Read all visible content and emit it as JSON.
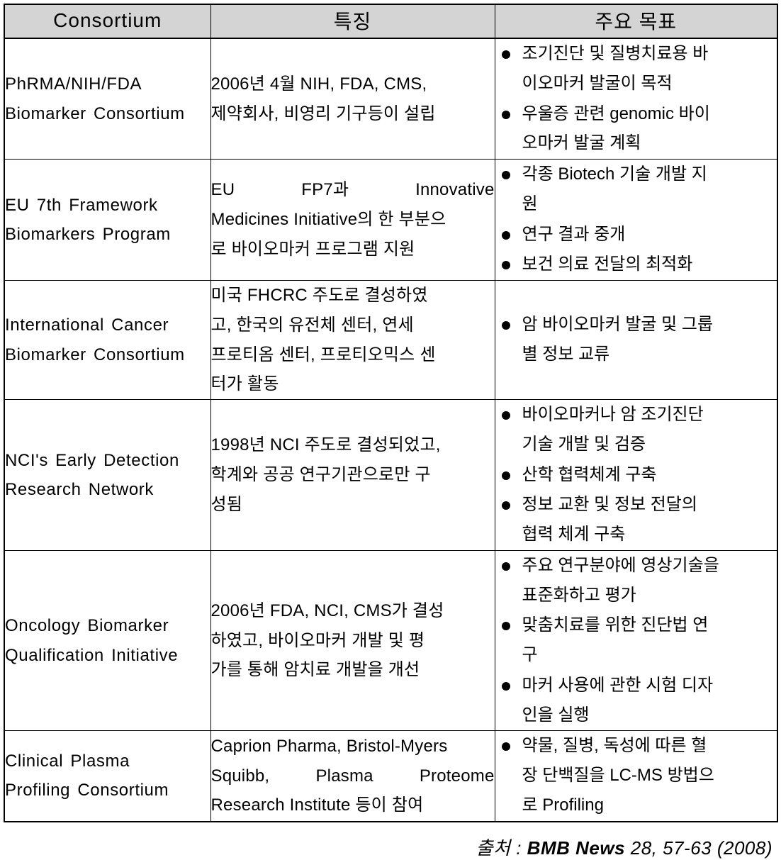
{
  "table": {
    "headers": {
      "consortium": "Consortium",
      "feature": "특징",
      "goal": "주요 목표"
    },
    "rows": [
      {
        "name_lines": [
          "PhRMA/NIH/FDA",
          "Biomarker Consortium"
        ],
        "name": "PhRMA/NIH/FDA Biomarker Consortium",
        "feature_lines": [
          "2006년 4월 NIH, FDA, CMS,",
          "제약회사, 비영리 기구등이 설립"
        ],
        "feature": "2006년 4월 NIH, FDA, CMS, 제약회사, 비영리 기구등이 설립",
        "goals": [
          "조기진단 및 질병치료용 바이오마커 발굴이 목적",
          "우울증 관련 genomic 바이오마커 발굴 계획"
        ],
        "goal_lines": [
          [
            "조기진단 및 질병치료용 바",
            "이오마커 발굴이 목적"
          ],
          [
            "우울증 관련 genomic 바이",
            "오마커 발굴 계획"
          ]
        ]
      },
      {
        "name_lines": [
          "EU 7th Framework",
          "Biomarkers Program"
        ],
        "name": "EU 7th Framework Biomarkers Program",
        "feature_lines": [
          "EU FP7과 Innovative",
          "Medicines Initiative의 한 부분으",
          "로 바이오마커 프로그램 지원"
        ],
        "feature": "EU FP7과 Innovative Medicines Initiative의 한 부분으로 바이오마커 프로그램 지원",
        "goals": [
          "각종 Biotech 기술 개발 지원",
          "연구 결과 중개",
          "보건 의료 전달의 최적화"
        ],
        "goal_lines": [
          [
            "각종 Biotech 기술 개발 지",
            "원"
          ],
          [
            "연구 결과 중개"
          ],
          [
            "보건 의료 전달의 최적화"
          ]
        ]
      },
      {
        "name_lines": [
          "International Cancer",
          "Biomarker Consortium"
        ],
        "name": "International Cancer Biomarker Consortium",
        "feature_lines": [
          "미국 FHCRC 주도로 결성하였",
          "고, 한국의 유전체 센터, 연세",
          "프로티옴 센터, 프로티오믹스 센",
          "터가 활동"
        ],
        "feature": "미국 FHCRC 주도로 결성하였고, 한국의 유전체 센터, 연세 프로티옴 센터, 프로티오믹스 센터가 활동",
        "goals": [
          "암 바이오마커 발굴 및 그룹별 정보 교류"
        ],
        "goal_lines": [
          [
            "암 바이오마커 발굴 및 그룹",
            "별 정보 교류"
          ]
        ]
      },
      {
        "name_lines": [
          "NCI's Early Detection",
          "Research Network"
        ],
        "name": "NCI's Early Detection Research Network",
        "feature_lines": [
          "1998년 NCI 주도로 결성되었고,",
          "학계와 공공 연구기관으로만 구",
          "성됨"
        ],
        "feature": "1998년 NCI 주도로 결성되었고, 학계와 공공 연구기관으로만 구성됨",
        "goals": [
          "바이오마커나 암 조기진단 기술 개발 및 검증",
          "산학 협력체계 구축",
          "정보 교환 및 정보 전달의 협력 체계 구축"
        ],
        "goal_lines": [
          [
            "바이오마커나 암 조기진단",
            "기술 개발 및 검증"
          ],
          [
            "산학 협력체계 구축"
          ],
          [
            "정보 교환 및 정보 전달의",
            "협력 체계 구축"
          ]
        ]
      },
      {
        "name_lines": [
          "Oncology Biomarker",
          "Qualification Initiative"
        ],
        "name": "Oncology Biomarker Qualification Initiative",
        "feature_lines": [
          "2006년 FDA, NCI, CMS가 결성",
          "하였고, 바이오마커 개발 및 평",
          "가를 통해 암치료 개발을 개선"
        ],
        "feature": "2006년 FDA, NCI, CMS가 결성하였고, 바이오마커 개발 및 평가를 통해 암치료 개발을 개선",
        "goals": [
          "주요 연구분야에 영상기술을 표준화하고 평가",
          "맞춤치료를 위한 진단법 연구",
          "마커 사용에 관한 시험 디자인을 실행"
        ],
        "goal_lines": [
          [
            "주요 연구분야에 영상기술을",
            "표준화하고 평가"
          ],
          [
            "맞춤치료를 위한 진단법 연",
            "구"
          ],
          [
            "마커 사용에 관한 시험 디자",
            "인을 실행"
          ]
        ]
      },
      {
        "name_lines": [
          "Clinical Plasma",
          "Profiling Consortium"
        ],
        "name": "Clinical Plasma Profiling Consortium",
        "feature_lines": [
          "Caprion Pharma, Bristol-Myers",
          "Squibb, Plasma Proteome",
          "Research Institute 등이 참여"
        ],
        "feature": "Caprion Pharma, Bristol-Myers Squibb, Plasma Proteome Research Institute 등이 참여",
        "goals": [
          "약물, 질병, 독성에 따른 혈장 단백질을 LC-MS 방법으로 Profiling"
        ],
        "goal_lines": [
          [
            "약물, 질병, 독성에 따른 혈",
            "장 단백질을 LC-MS 방법으",
            "로 Profiling"
          ]
        ]
      }
    ]
  },
  "caption": {
    "prefix": "출처 : ",
    "source_name": "BMB News",
    "details": " 28, 57-63 (2008)",
    "full": "출처 : BMB News 28, 57-63 (2008)"
  },
  "colors": {
    "header_background": "#d4d4d4",
    "border": "#000000",
    "text": "#000000",
    "page_background": "#ffffff"
  }
}
